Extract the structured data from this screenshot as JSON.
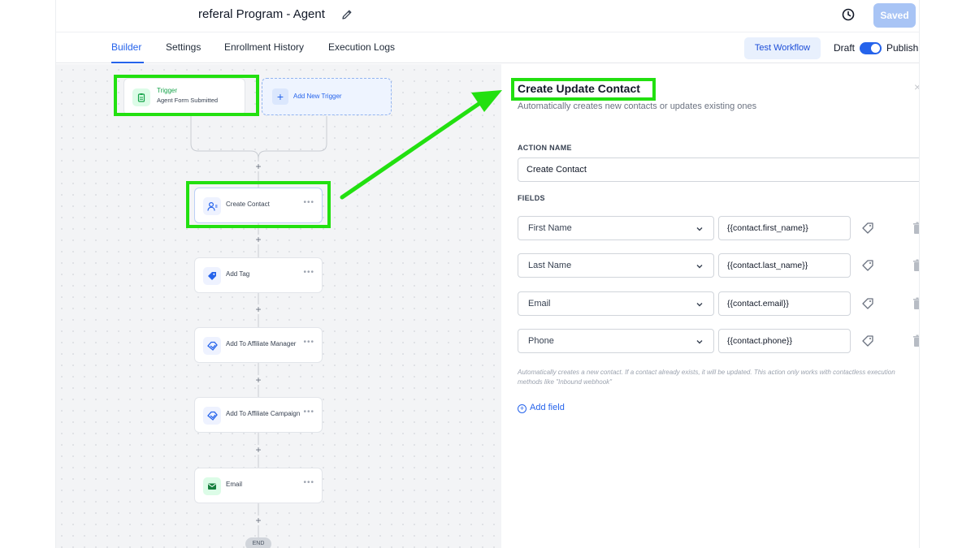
{
  "header": {
    "title": "referal Program - Agent",
    "saved_label": "Saved"
  },
  "tabs": [
    {
      "label": "Builder",
      "active": true
    },
    {
      "label": "Settings",
      "active": false
    },
    {
      "label": "Enrollment History",
      "active": false
    },
    {
      "label": "Execution Logs",
      "active": false
    }
  ],
  "toolbar": {
    "test_workflow": "Test Workflow",
    "draft": "Draft",
    "publish": "Publish",
    "publish_toggle_on": true
  },
  "canvas": {
    "trigger": {
      "title": "Trigger",
      "subtitle": "Agent Form Submitted"
    },
    "add_trigger": "Add New Trigger",
    "nodes": [
      {
        "label": "Create Contact",
        "icon": "user-icon"
      },
      {
        "label": "Add Tag",
        "icon": "tag-icon"
      },
      {
        "label": "Add To Affiliate Manager",
        "icon": "affiliate-icon"
      },
      {
        "label": "Add To Affiliate Campaign",
        "icon": "affiliate-icon"
      },
      {
        "label": "Email",
        "icon": "email-icon"
      }
    ],
    "end_label": "END"
  },
  "panel": {
    "title": "Create Update Contact",
    "subtitle": "Automatically creates new contacts or updates existing ones",
    "action_name_label": "ACTION NAME",
    "action_name_value": "Create Contact",
    "fields_label": "FIELDS",
    "fields": [
      {
        "name": "First Name",
        "value": "{{contact.first_name}}"
      },
      {
        "name": "Last Name",
        "value": "{{contact.last_name}}"
      },
      {
        "name": "Email",
        "value": "{{contact.email}}"
      },
      {
        "name": "Phone",
        "value": "{{contact.phone}}"
      }
    ],
    "note": "Automatically creates a new contact. If a contact already exists, it will be updated. This action only works with contactless execution methods like \"Inbound webhook\"",
    "add_field": "Add field"
  },
  "colors": {
    "accent": "#2563eb",
    "highlight": "#22e010",
    "saved_button": "#a8c4f5"
  }
}
